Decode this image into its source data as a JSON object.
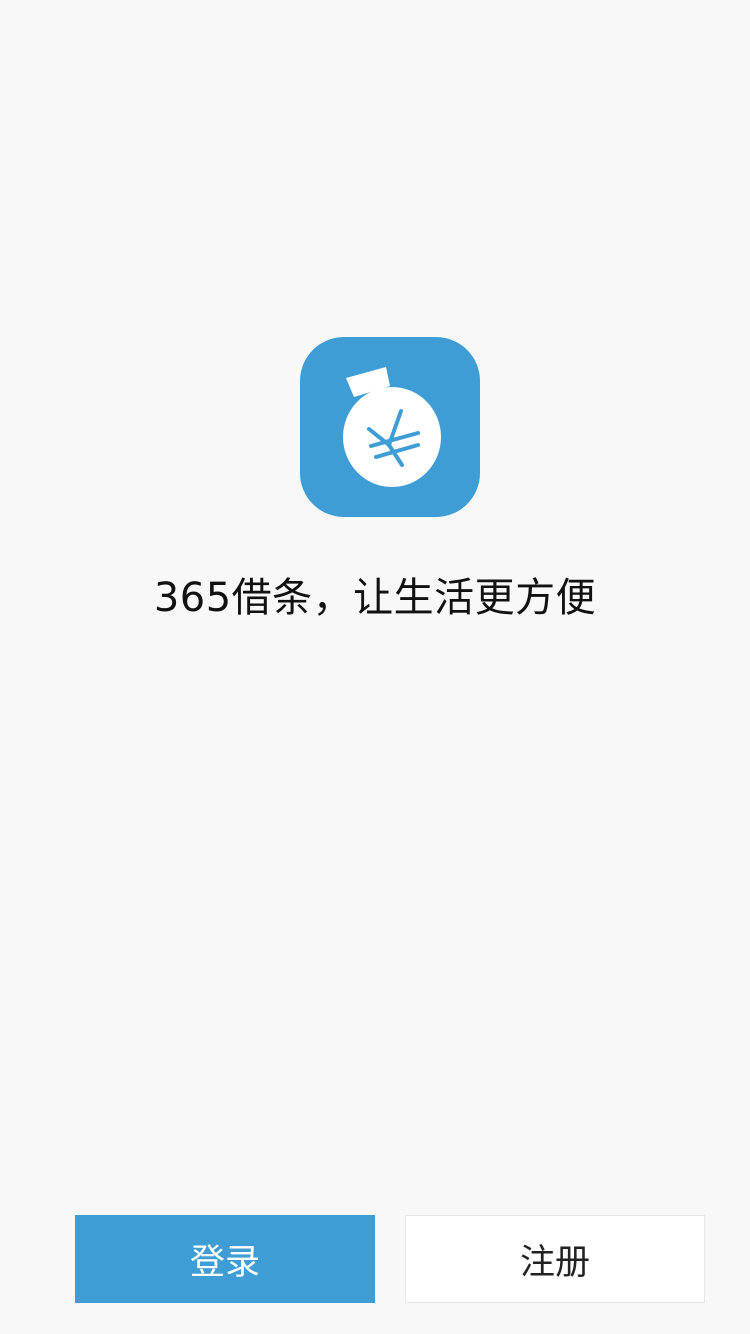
{
  "app": {
    "icon_name": "money-bag-yuan-icon",
    "accent_color": "#3f9dd6",
    "tagline": "365借条，让生活更方便"
  },
  "actions": {
    "login_label": "登录",
    "register_label": "注册"
  }
}
